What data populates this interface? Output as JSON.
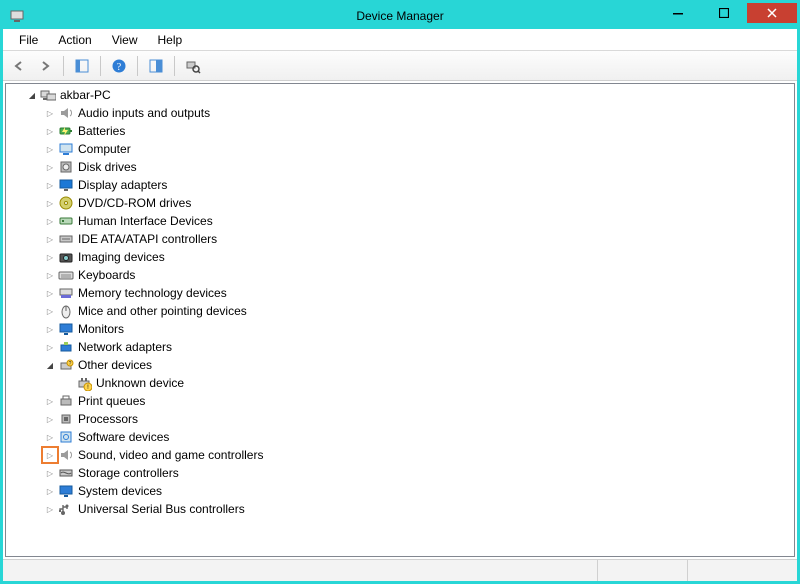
{
  "title": "Device Manager",
  "menu": {
    "file": "File",
    "action": "Action",
    "view": "View",
    "help": "Help"
  },
  "root": {
    "label": "akbar-PC"
  },
  "categories": [
    {
      "icon": "audio",
      "label": "Audio inputs and outputs",
      "state": "closed"
    },
    {
      "icon": "battery",
      "label": "Batteries",
      "state": "closed"
    },
    {
      "icon": "computer",
      "label": "Computer",
      "state": "closed"
    },
    {
      "icon": "disk",
      "label": "Disk drives",
      "state": "closed"
    },
    {
      "icon": "display",
      "label": "Display adapters",
      "state": "closed"
    },
    {
      "icon": "dvd",
      "label": "DVD/CD-ROM drives",
      "state": "closed"
    },
    {
      "icon": "hid",
      "label": "Human Interface Devices",
      "state": "closed"
    },
    {
      "icon": "ide",
      "label": "IDE ATA/ATAPI controllers",
      "state": "closed"
    },
    {
      "icon": "imaging",
      "label": "Imaging devices",
      "state": "closed"
    },
    {
      "icon": "keyboard",
      "label": "Keyboards",
      "state": "closed"
    },
    {
      "icon": "memory",
      "label": "Memory technology devices",
      "state": "closed"
    },
    {
      "icon": "mouse",
      "label": "Mice and other pointing devices",
      "state": "closed"
    },
    {
      "icon": "monitor",
      "label": "Monitors",
      "state": "closed"
    },
    {
      "icon": "network",
      "label": "Network adapters",
      "state": "closed"
    },
    {
      "icon": "other",
      "label": "Other devices",
      "state": "open",
      "children": [
        {
          "icon": "unknown",
          "label": "Unknown device"
        }
      ]
    },
    {
      "icon": "printer",
      "label": "Print queues",
      "state": "closed"
    },
    {
      "icon": "cpu",
      "label": "Processors",
      "state": "closed"
    },
    {
      "icon": "software",
      "label": "Software devices",
      "state": "closed"
    },
    {
      "icon": "sound",
      "label": "Sound, video and game controllers",
      "state": "closed",
      "highlight": true
    },
    {
      "icon": "storage",
      "label": "Storage controllers",
      "state": "closed"
    },
    {
      "icon": "system",
      "label": "System devices",
      "state": "closed"
    },
    {
      "icon": "usb",
      "label": "Universal Serial Bus controllers",
      "state": "closed"
    }
  ]
}
